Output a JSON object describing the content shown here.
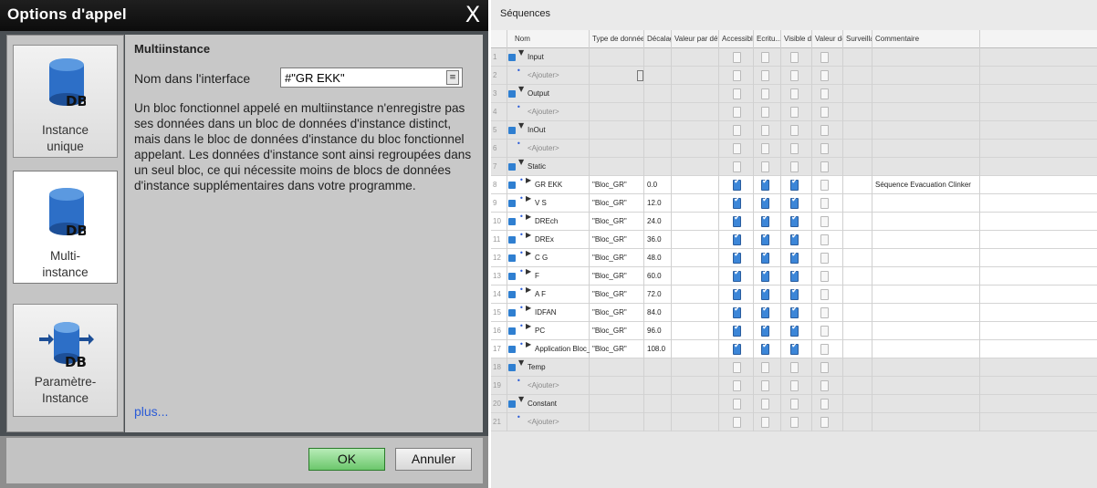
{
  "dialog": {
    "title": "Options d'appel",
    "close_glyph": "X",
    "options": [
      {
        "label_line1": "Instance",
        "label_line2": "unique",
        "icon": "db-icon",
        "selected": false
      },
      {
        "label_line1": "Multi-",
        "label_line2": "instance",
        "icon": "db-icon",
        "selected": true
      },
      {
        "label_line1": "Paramètre-",
        "label_line2": "Instance",
        "icon": "db-arrows-icon",
        "selected": false
      }
    ],
    "section_title": "Multiinstance",
    "name_label": "Nom dans l'interface",
    "name_value": "#\"GR EKK\"",
    "description": "Un bloc fonctionnel appelé en multiinstance n'enregistre pas ses données dans un bloc de données d'instance distinct, mais dans le bloc de données d'instance du bloc fonctionnel appelant. Les données d'instance sont ainsi regroupées dans un seul bloc, ce qui nécessite moins de blocs de données d'instance supplémentaires dans votre programme.",
    "more_link": "plus...",
    "ok_label": "OK",
    "cancel_label": "Annuler",
    "db_text": "DB"
  },
  "table": {
    "title": "Séquences",
    "columns": [
      "Nom",
      "Type de données",
      "Décalage",
      "Valeur par déf.",
      "Accessible ...",
      "Ecritu...",
      "Visible da...",
      "Valeur de ...",
      "Surveilla...",
      "Commentaire"
    ],
    "rows": [
      {
        "num": "1",
        "kind": "section",
        "name": "Input"
      },
      {
        "num": "2",
        "kind": "add",
        "name": "<Ajouter>"
      },
      {
        "num": "3",
        "kind": "section",
        "name": "Output"
      },
      {
        "num": "4",
        "kind": "add",
        "name": "<Ajouter>"
      },
      {
        "num": "5",
        "kind": "section",
        "name": "InOut"
      },
      {
        "num": "6",
        "kind": "add",
        "name": "<Ajouter>"
      },
      {
        "num": "7",
        "kind": "section",
        "name": "Static"
      },
      {
        "num": "8",
        "kind": "member",
        "name": "GR EKK",
        "type": "\"Bloc_GR\"",
        "offset": "0.0",
        "comment": "Séquence Evacuation Clinker"
      },
      {
        "num": "9",
        "kind": "member",
        "name": "V S",
        "type": "\"Bloc_GR\"",
        "offset": "12.0",
        "comment": ""
      },
      {
        "num": "10",
        "kind": "member",
        "name": "DREch",
        "type": "\"Bloc_GR\"",
        "offset": "24.0",
        "comment": ""
      },
      {
        "num": "11",
        "kind": "member",
        "name": "DREx",
        "type": "\"Bloc_GR\"",
        "offset": "36.0",
        "comment": ""
      },
      {
        "num": "12",
        "kind": "member",
        "name": "C G",
        "type": "\"Bloc_GR\"",
        "offset": "48.0",
        "comment": ""
      },
      {
        "num": "13",
        "kind": "member",
        "name": "F",
        "type": "\"Bloc_GR\"",
        "offset": "60.0",
        "comment": ""
      },
      {
        "num": "14",
        "kind": "member",
        "name": "A F",
        "type": "\"Bloc_GR\"",
        "offset": "72.0",
        "comment": ""
      },
      {
        "num": "15",
        "kind": "member",
        "name": "IDFAN",
        "type": "\"Bloc_GR\"",
        "offset": "84.0",
        "comment": ""
      },
      {
        "num": "16",
        "kind": "member",
        "name": "PC",
        "type": "\"Bloc_GR\"",
        "offset": "96.0",
        "comment": ""
      },
      {
        "num": "17",
        "kind": "member",
        "name": "Application Bloc_MT",
        "type": "\"Bloc_GR\"",
        "offset": "108.0",
        "comment": ""
      },
      {
        "num": "18",
        "kind": "section",
        "name": "Temp"
      },
      {
        "num": "19",
        "kind": "add",
        "name": "<Ajouter>"
      },
      {
        "num": "20",
        "kind": "section",
        "name": "Constant"
      },
      {
        "num": "21",
        "kind": "add",
        "name": "<Ajouter>"
      }
    ]
  }
}
